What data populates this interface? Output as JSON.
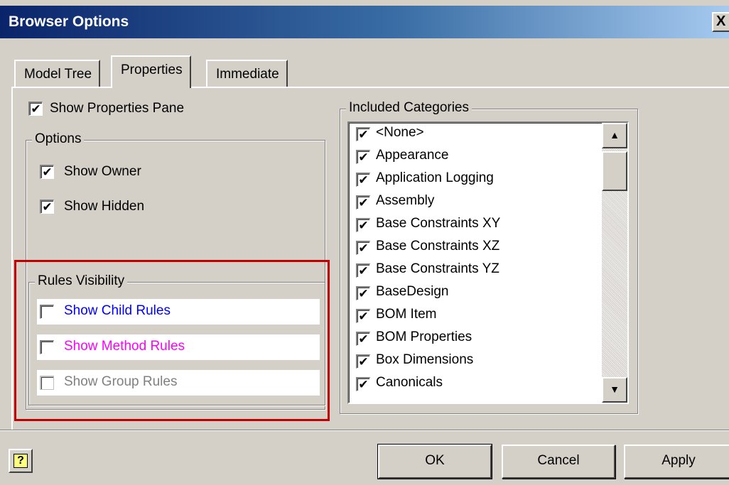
{
  "window": {
    "title": "Browser Options",
    "close_glyph": "X"
  },
  "tabs": [
    {
      "label": "Model Tree"
    },
    {
      "label": "Properties"
    },
    {
      "label": "Immediate"
    }
  ],
  "properties": {
    "show_pane": {
      "label": "Show Properties Pane",
      "checked": true
    },
    "options": {
      "title": "Options",
      "show_owner": {
        "label": "Show Owner",
        "checked": true
      },
      "show_hidden": {
        "label": "Show Hidden",
        "checked": true
      }
    },
    "rules_visibility": {
      "title": "Rules Visibility",
      "items": [
        {
          "label": "Show Child Rules",
          "checked": false,
          "color": "#0000ff"
        },
        {
          "label": "Show Method Rules",
          "checked": false,
          "color": "#ff00ff"
        },
        {
          "label": "Show Group Rules",
          "checked": false,
          "color": "#808080"
        }
      ]
    },
    "categories": {
      "title": "Included Categories",
      "items": [
        {
          "label": "<None>",
          "checked": true
        },
        {
          "label": "Appearance",
          "checked": true
        },
        {
          "label": "Application Logging",
          "checked": true
        },
        {
          "label": "Assembly",
          "checked": true
        },
        {
          "label": "Base Constraints XY",
          "checked": true
        },
        {
          "label": "Base Constraints XZ",
          "checked": true
        },
        {
          "label": "Base Constraints YZ",
          "checked": true
        },
        {
          "label": "BaseDesign",
          "checked": true
        },
        {
          "label": "BOM Item",
          "checked": true
        },
        {
          "label": "BOM Properties",
          "checked": true
        },
        {
          "label": "Box Dimensions",
          "checked": true
        },
        {
          "label": "Canonicals",
          "checked": true
        }
      ]
    }
  },
  "buttons": {
    "help": "?",
    "ok": "OK",
    "cancel": "Cancel",
    "apply": "Apply"
  },
  "icons": {
    "check": "✔",
    "scroll_up": "▲",
    "scroll_down": "▼"
  }
}
